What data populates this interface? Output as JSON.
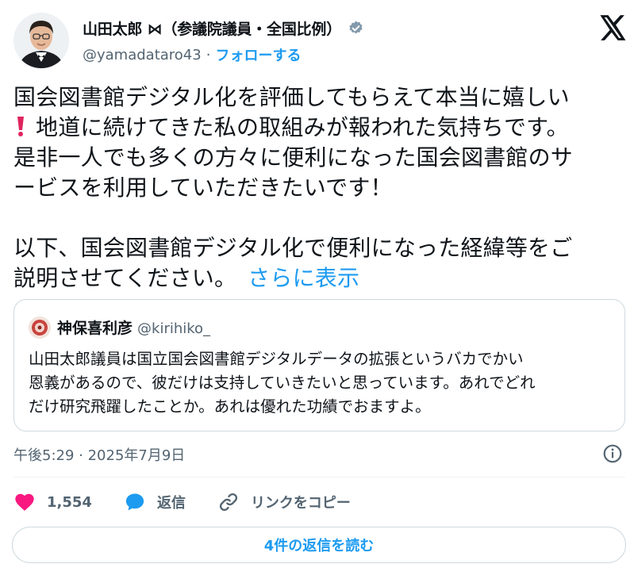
{
  "author": {
    "display_name": "山田太郎 ⋈（参議院議員・全国比例）",
    "handle": "@yamadataro43",
    "separator": "·",
    "follow_label": "フォローする",
    "verified_color": "#829aab"
  },
  "tweet": {
    "line1": "国会図書館デジタル化を評価してもらえて本当に嬉しい",
    "line2": "地道に続けてきた私の取組みが報われた気持ちです。",
    "line3": "是非一人でも多くの方々に便利になった国会図書館のサ",
    "line4": "ービスを利用していただきたいです！",
    "line5": "以下、国会図書館デジタル化で便利になった経緯等をご",
    "line6": "説明させてください。",
    "show_more_label": "さらに表示"
  },
  "quote": {
    "display_name": "神保喜利彦",
    "handle": "@kirihiko_",
    "line1": "山田太郎議員は国立国会図書館デジタルデータの拡張というバカでかい",
    "line2": "恩義があるので、彼だけは支持していきたいと思っています。あれでどれ",
    "line3": "だけ研究飛躍したことか。あれは優れた功績でおますよ。"
  },
  "timestamp": "午後5:29 · 2025年7月9日",
  "actions": {
    "like_count": "1,554",
    "reply_label": "返信",
    "copy_link_label": "リンクをコピー"
  },
  "read_replies_label": "4件の返信を読む",
  "colors": {
    "accent": "#1d9bf0",
    "like": "#f91880",
    "muted": "#536471",
    "border": "#cfd9de"
  }
}
